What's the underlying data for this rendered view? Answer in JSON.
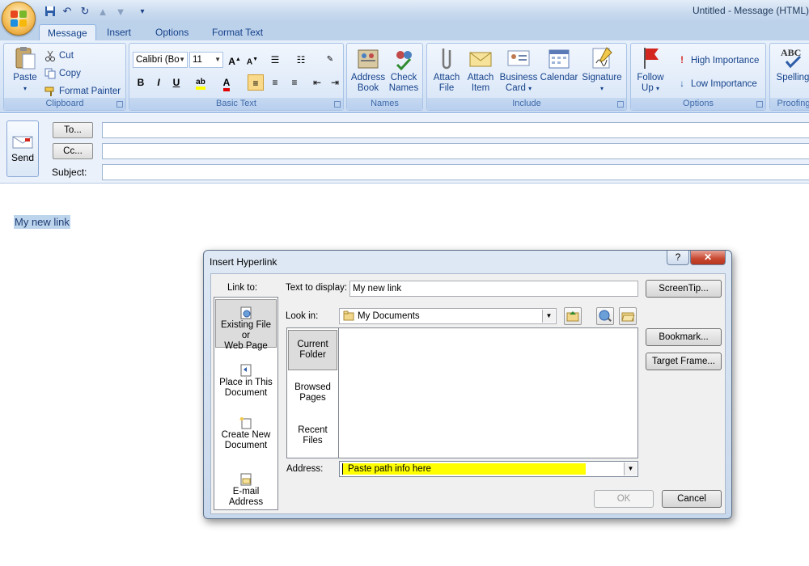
{
  "window": {
    "title": "Untitled - Message (HTML)"
  },
  "tabs": [
    "Message",
    "Insert",
    "Options",
    "Format Text"
  ],
  "ribbon": {
    "clipboard": {
      "label": "Clipboard",
      "paste": "Paste",
      "cut": "Cut",
      "copy": "Copy",
      "format_painter": "Format Painter"
    },
    "basic_text": {
      "label": "Basic Text",
      "font": "Calibri (Bo",
      "size": "11"
    },
    "names": {
      "label": "Names",
      "address_book_1": "Address",
      "address_book_2": "Book",
      "check_names_1": "Check",
      "check_names_2": "Names"
    },
    "include": {
      "label": "Include",
      "attach_file_1": "Attach",
      "attach_file_2": "File",
      "attach_item_1": "Attach",
      "attach_item_2": "Item",
      "business_card_1": "Business",
      "business_card_2": "Card",
      "calendar": "Calendar",
      "signature": "Signature"
    },
    "options": {
      "label": "Options",
      "follow_up_1": "Follow",
      "follow_up_2": "Up",
      "high_importance": "High Importance",
      "low_importance": "Low Importance"
    },
    "proofing": {
      "label": "Proofing",
      "spelling": "Spelling"
    }
  },
  "header": {
    "send": "Send",
    "to": "To...",
    "cc": "Cc...",
    "subject_label": "Subject:"
  },
  "body": {
    "selected_text": "My new link"
  },
  "dialog": {
    "title": "Insert Hyperlink",
    "help": "?",
    "link_to_label": "Link to:",
    "text_to_display_label": "Text to display:",
    "text_to_display_value": "My new link",
    "screentip": "ScreenTip...",
    "look_in_label": "Look in:",
    "look_in_value": "My Documents",
    "bookmark": "Bookmark...",
    "target_frame": "Target Frame...",
    "link_types": [
      {
        "line1": "Existing File or",
        "line2": "Web Page"
      },
      {
        "line1": "Place in This",
        "line2": "Document"
      },
      {
        "line1": "Create New",
        "line2": "Document"
      },
      {
        "line1": "E-mail Address",
        "line2": ""
      }
    ],
    "nav": [
      {
        "line1": "Current",
        "line2": "Folder"
      },
      {
        "line1": "Browsed",
        "line2": "Pages"
      },
      {
        "line1": "Recent",
        "line2": "Files"
      }
    ],
    "address_label": "Address:",
    "address_value": "Paste path info here",
    "ok": "OK",
    "cancel": "Cancel"
  },
  "colors": {
    "highlight": "#ffff00",
    "ribbon_bg": "#dce8f8",
    "selection": "#bcd4ec"
  }
}
